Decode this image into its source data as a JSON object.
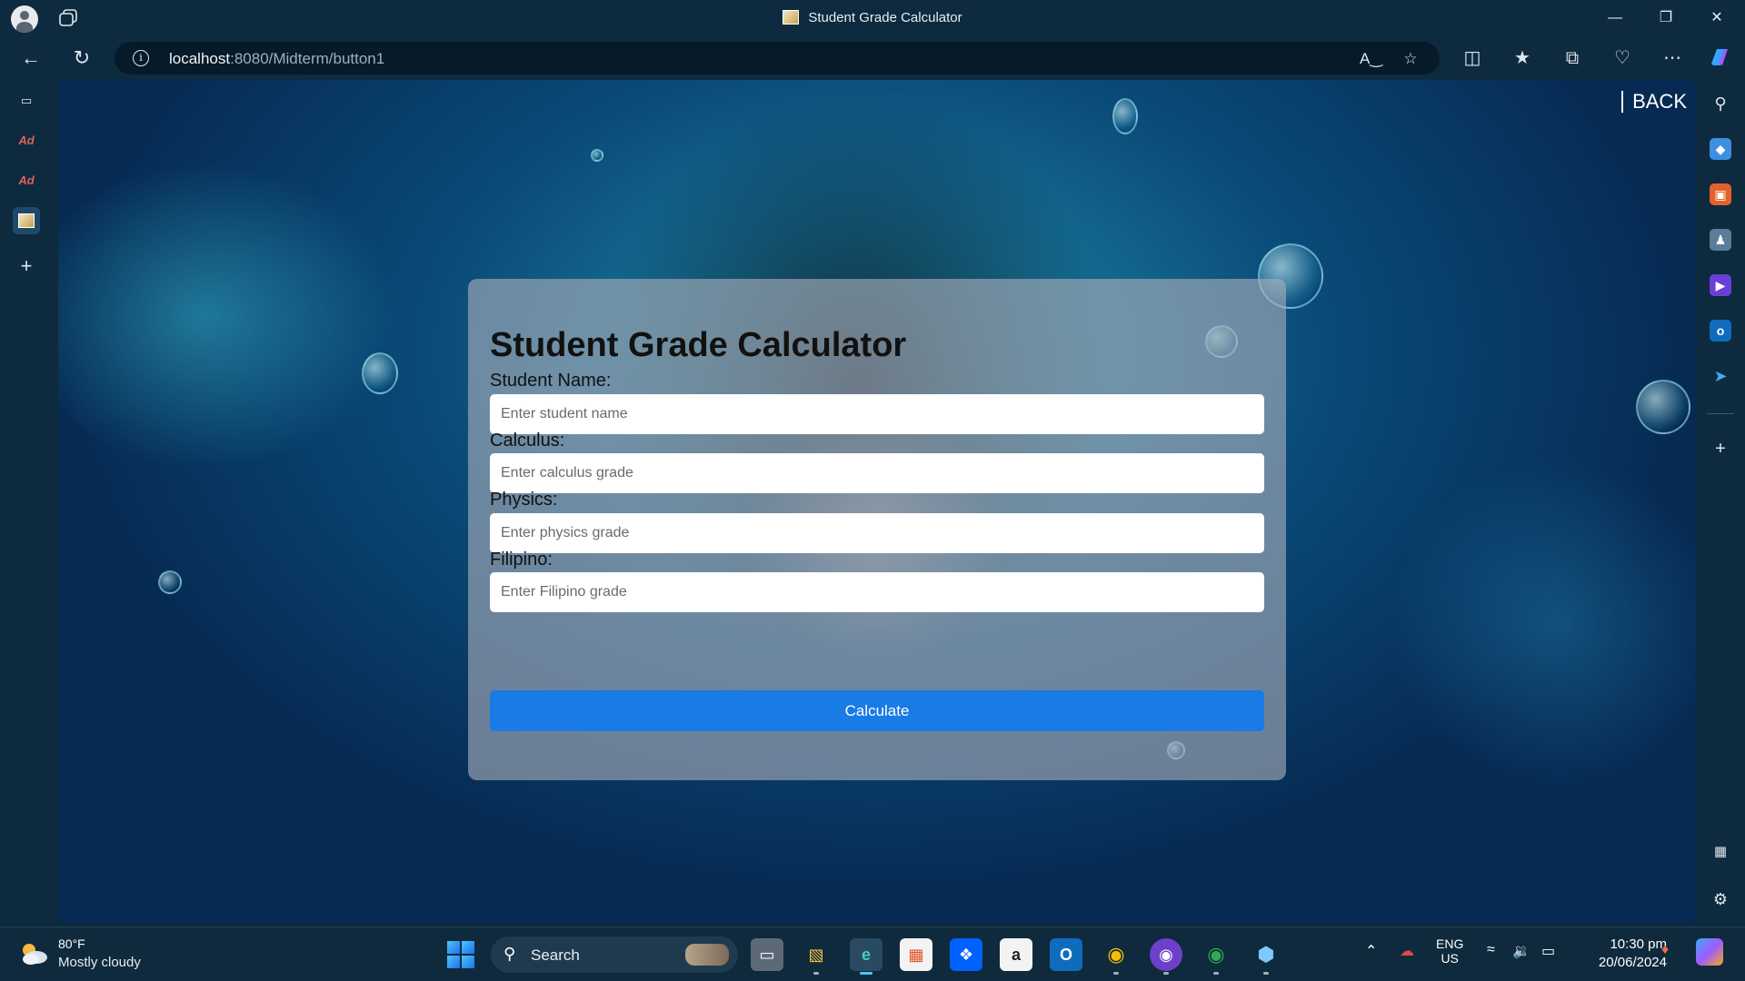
{
  "window": {
    "title": "Student Grade Calculator"
  },
  "address_bar": {
    "host": "localhost",
    "path": ":8080/Midterm/button1"
  },
  "page": {
    "back_label": "BACK",
    "heading": "Student Grade Calculator",
    "fields": [
      {
        "label": "Student Name:",
        "placeholder": "Enter student name"
      },
      {
        "label": "Calculus:",
        "placeholder": "Enter calculus grade"
      },
      {
        "label": "Physics:",
        "placeholder": "Enter physics grade"
      },
      {
        "label": "Filipino:",
        "placeholder": "Enter Filipino grade"
      }
    ],
    "calculate_label": "Calculate"
  },
  "taskbar": {
    "weather_temp": "80°F",
    "weather_desc": "Mostly cloudy",
    "search_label": "Search",
    "lang_line1": "ENG",
    "lang_line2": "US",
    "time": "10:30 pm",
    "date": "20/06/2024"
  },
  "colors": {
    "accent_button": "#1a7ae6",
    "chrome_bg": "#0d2a3f",
    "card_bg": "rgba(170,175,185,0.62)"
  },
  "icons": {
    "left_tabs": [
      "tab-actions-icon",
      "acrobat-tab-icon",
      "acrobat-tab-icon",
      "grade-calculator-tab-icon",
      "new-tab-icon"
    ],
    "right_sidebar": [
      "search-icon",
      "shopping-tag-icon",
      "toolbox-icon",
      "games-icon",
      "copilot-icon",
      "outlook-icon",
      "send-icon",
      "add-icon",
      "screenshot-icon",
      "settings-icon"
    ]
  }
}
